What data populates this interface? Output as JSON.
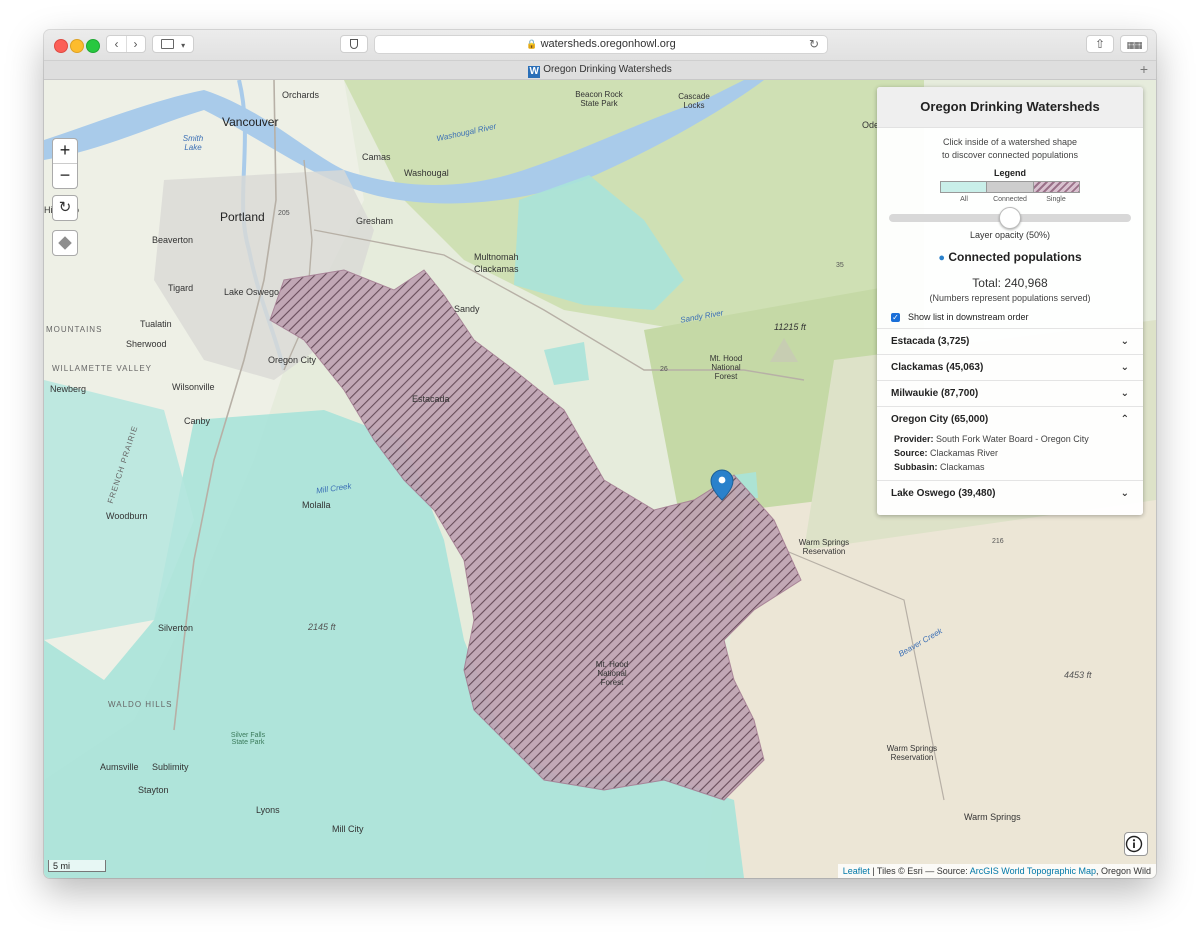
{
  "browser": {
    "url": "watersheds.oregonhowl.org",
    "tab_title": "Oregon Drinking Watersheds",
    "favicon_letter": "W",
    "icons": [
      "back-icon",
      "forward-icon",
      "sidebar-icon",
      "shield-icon",
      "lock-icon",
      "reload-icon",
      "share-icon",
      "tabs-grid-icon",
      "new-tab-icon"
    ]
  },
  "map": {
    "zoom_in": "+",
    "zoom_out": "−",
    "scale": "5 mi",
    "labels": {
      "orchards": "Orchards",
      "vancouver": "Vancouver",
      "camas": "Camas",
      "washougal": "Washougal",
      "hillsboro": "Hillsboro",
      "portland": "Portland",
      "gresham": "Gresham",
      "beaverton": "Beaverton",
      "tigard": "Tigard",
      "lake_oswego": "Lake Oswego",
      "tualatin": "Tualatin",
      "sherwood": "Sherwood",
      "oregon_city": "Oregon City",
      "wilsonville": "Wilsonville",
      "newberg": "Newberg",
      "canby": "Canby",
      "molalla": "Molalla",
      "woodburn": "Woodburn",
      "silverton": "Silverton",
      "aumsville": "Aumsville",
      "sublimity": "Sublimity",
      "stayton": "Stayton",
      "lyons": "Lyons",
      "mill_city": "Mill City",
      "sandy": "Sandy",
      "estacada": "Estacada",
      "multnomah": "Multnomah",
      "clackamas_lbl": "Clackamas",
      "beacon_rock": "Beacon Rock State Park",
      "cascade_locks": "Cascade Locks",
      "mt_hood_nf": "Mt. Hood National Forest",
      "mt_hood_nf2": "Mt. Hood National Forest",
      "elev_hood": "11215 ft",
      "elev_2145": "2145 ft",
      "elev_4453": "4453 ft",
      "warm_springs_res": "Warm Springs Reservation",
      "warm_springs_res2": "Warm Springs Reservation",
      "warm_springs": "Warm Springs",
      "mountains": "MOUNTAINS",
      "willamette_valley": "WILLAMETTE VALLEY",
      "waldo_hills": "WALDO HILLS",
      "french_prairie": "FRENCH PRAIRIE",
      "smith_lake": "Smith Lake",
      "silver_falls": "Silver Falls State Park",
      "washougal_river": "Washougal River",
      "sandy_river": "Sandy River",
      "mill_creek": "Mill Creek",
      "beaver_creek": "Beaver Creek",
      "odell": "Odel",
      "hwy_205": "205",
      "hwy_216": "216",
      "hwy_26": "26",
      "hwy_35": "35"
    },
    "colors": {
      "all_watersheds": "#a9e3d9",
      "single_watershed": "#b89aaa",
      "marker": "#2a81cb"
    }
  },
  "panel": {
    "title": "Oregon Drinking Watersheds",
    "hint_line1": "Click inside of a watershed shape",
    "hint_line2": "to discover connected populations",
    "legend_title": "Legend",
    "legend_labels": [
      "All",
      "Connected",
      "Single"
    ],
    "opacity_percent": 50,
    "opacity_label": "Layer opacity (50%)",
    "connected_title": "Connected populations",
    "total": "Total: 240,968",
    "note": "(Numbers represent populations served)",
    "checkbox_label": "Show list in downstream order",
    "items": [
      {
        "label": "Estacada (3,725)"
      },
      {
        "label": "Clackamas (45,063)"
      },
      {
        "label": "Milwaukie (87,700)"
      },
      {
        "label": "Oregon City (65,000)",
        "provider_label": "Provider:",
        "provider": "South Fork Water Board - Oregon City",
        "source_label": "Source:",
        "source": "Clackamas River",
        "subbasin_label": "Subbasin:",
        "subbasin": "Clackamas"
      },
      {
        "label": "Lake Oswego (39,480)"
      }
    ]
  },
  "attribution": {
    "leaflet": "Leaflet",
    "tiles": " | Tiles © Esri — Source: ",
    "arcgis": "ArcGIS World Topographic Map",
    "suffix": ", Oregon Wild"
  }
}
